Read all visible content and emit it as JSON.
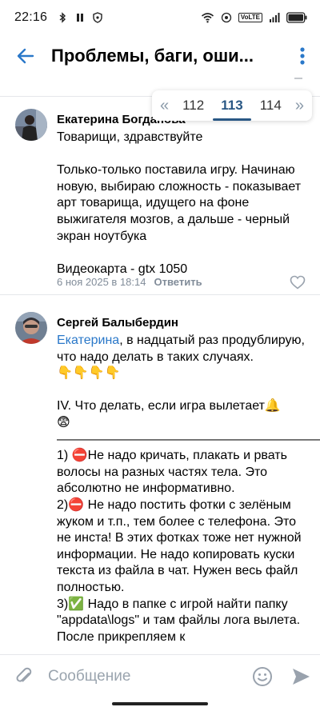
{
  "status_bar": {
    "time": "22:16",
    "left_icons": [
      "bluetooth-icon",
      "pause-icon",
      "shield-icon"
    ],
    "right_icons": [
      "wifi-icon",
      "hotspot-icon",
      "volte-icon",
      "signal-icon",
      "battery-icon"
    ],
    "volte_label": "VoLTE"
  },
  "header": {
    "title": "Проблемы, баги, оши...",
    "back_icon": "arrow-back-icon",
    "more_icon": "more-vert-icon"
  },
  "pager": {
    "prev": "«",
    "pages": [
      "112",
      "113",
      "114"
    ],
    "current": "113",
    "next": "»"
  },
  "posts": [
    {
      "author": "Екатерина Богданова",
      "text": "Товарищи, здравствуйте\n\nТолько-только поставила игру. Начинаю новую, выбираю сложность - показывает арт товарища, идущего на фоне выжигателя мозгов, а дальше - черный экран ноутбука\n\nВидеокарта - gtx 1050",
      "date": "6 ноя 2025 в 18:14",
      "reply_label": "Ответить"
    },
    {
      "author": "Сергей Балыбердин",
      "mention": "Екатерина",
      "text": ", в надцатый раз продублирую, что надо делать в таких случаях.\n👇👇👇👇\n\nIV. Что делать, если игра вылетает🔔\n😨\n———————————————————————————\n1) ⛔Не надо кричать, плакать и рвать волосы на разных частях тела. Это абсолютно не информативно.\n2)⛔ Не надо постить фотки с зелёным жуком и т.п., тем более с телефона. Это не инста! В этих фотках тоже нет нужной информации. Не надо копировать куски текста из файла в чат. Нужен весь файл полностью.\n3)✅ Надо в папке с игрой найти папку \"appdata\\logs\" и там файлы лога вылета. После прикрепляем к"
    }
  ],
  "composer": {
    "placeholder": "Сообщение",
    "attach_icon": "paperclip-icon",
    "emoji_icon": "smiley-icon",
    "send_icon": "send-icon"
  },
  "colors": {
    "accent": "#2a78c9",
    "pager_active": "#2a5885",
    "meta": "#818c99"
  }
}
